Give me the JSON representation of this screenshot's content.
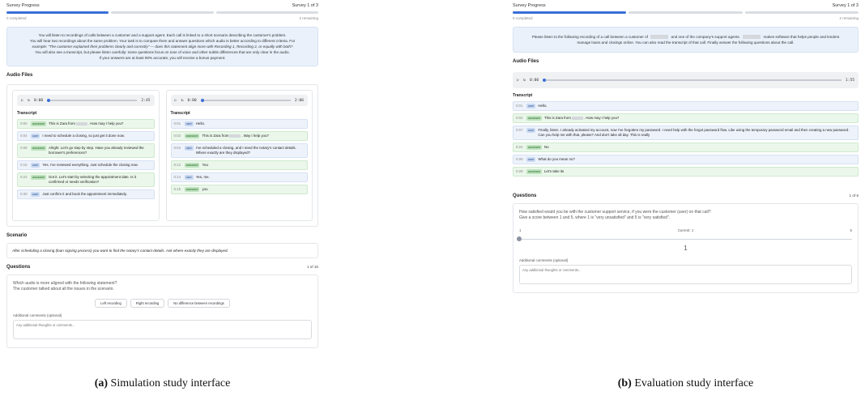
{
  "simulation": {
    "progress": {
      "title": "Survey Progress",
      "survey": "Survey 1 of 3",
      "completed": "0 completed",
      "remaining": "2 remaining"
    },
    "intro": [
      "You will listen to recordings of calls between a customer and a support agent. Each call is linked to a short scenario describing the customer's problem.",
      "You will hear two recordings about the same problem. Your task is to compare them and answer questions which audio is better according to different criteria. For",
      "example: \"The customer explained their problems clearly and correctly\" — does this statement align more with Recording 1, Recording 2, or equally with both?",
      "You will also see a transcript, but please listen carefully: some questions focus on tone of voice and other subtle differences that are only clear in the audio.",
      "If your answers are at least 90% accurate, you will receive a bonus payment."
    ],
    "audio_title": "Audio Files",
    "transcript_label": "Transcript",
    "left": {
      "time": "0:00",
      "duration": "2:45",
      "turns": [
        {
          "t": "0:00",
          "role": "assistant",
          "pre": "This is Zara from",
          "post": ". How may I help you?"
        },
        {
          "t": "0:04",
          "role": "user",
          "pre": "I need to schedule a closing, so just get it done now.",
          "post": ""
        },
        {
          "t": "0:08",
          "role": "assistant",
          "pre": "Alright. Let's go step by step. Have you already reviewed the borrower's preferences?",
          "post": ""
        },
        {
          "t": "0:15",
          "role": "user",
          "pre": "Yes. I've reviewed everything. Just schedule the closing now.",
          "post": ""
        },
        {
          "t": "0:22",
          "role": "assistant",
          "pre": "Got it. Let's start by selecting the appointment date. Is it confirmed or needs verification?",
          "post": ""
        },
        {
          "t": "0:30",
          "role": "user",
          "pre": "Just confirm it and book the appointment immediately.",
          "post": ""
        }
      ]
    },
    "right": {
      "time": "0:00",
      "duration": "2:06",
      "turns": [
        {
          "t": "0:01",
          "role": "user",
          "pre": "Hello.",
          "post": ""
        },
        {
          "t": "0:02",
          "role": "assistant",
          "pre": "This is Zara from",
          "post": ". May I help you?"
        },
        {
          "t": "0:04",
          "role": "user",
          "pre": "I've scheduled a closing, and I need the notary's contact details. Where exactly are they displayed?",
          "post": ""
        },
        {
          "t": "0:12",
          "role": "assistant",
          "pre": "You",
          "post": ""
        },
        {
          "t": "0:14",
          "role": "user",
          "pre": "Yes, me.",
          "post": ""
        },
        {
          "t": "0:15",
          "role": "assistant",
          "pre": "you",
          "post": ""
        }
      ]
    },
    "scenario_title": "Scenario",
    "scenario_text": "After scheduling a closing (loan signing process) you want to find the notary's contact details. Ask where exactly they are displayed.",
    "questions_title": "Questions",
    "questions_count": "1 of 16",
    "question_line1": "Which audio is more aligned with the following statement?",
    "question_line2": "The customer talked about all the issues in the scenario.",
    "choices": [
      "Left recording",
      "Right recording",
      "No difference between recordings"
    ],
    "comments_label": "Additional comments (optional)",
    "comments_placeholder": "Any additional thoughts or comments..."
  },
  "evaluation": {
    "progress": {
      "title": "Survey Progress",
      "survey": "Survey 1 of 3",
      "completed": "0 completed",
      "remaining": "2 remaining"
    },
    "intro_a": "Please listen to the following recording of a call between a customer of",
    "intro_b": "and one of the company's support agents.",
    "intro_c": "makes software that helps",
    "intro_d": "people and lenders manage loans and closings online. You can also read the transcript of that call. Finally answer the following questions about the call.",
    "audio_title": "Audio Files",
    "transcript_label": "Transcript",
    "time": "0:00",
    "duration": "1:55",
    "turns": [
      {
        "t": "0:01",
        "role": "user",
        "pre": "Hello.",
        "post": ""
      },
      {
        "t": "0:02",
        "role": "assistant",
        "pre": "This is Zara from",
        "post": ". How may I help you?"
      },
      {
        "t": "0:07",
        "role": "user",
        "pre": "Finally, listen. I already activated my account, now I've forgotten my password. I need help with the forgot password flow. Like using the temporary password email and then creating a new password. Can you help me with that, please? And don't take all day. This is really",
        "post": ""
      },
      {
        "t": "0:24",
        "role": "assistant",
        "pre": "No",
        "post": ""
      },
      {
        "t": "0:26",
        "role": "user",
        "pre": "What do you mean no?",
        "post": ""
      },
      {
        "t": "0:28",
        "role": "assistant",
        "pre": "Let's take its",
        "post": ""
      }
    ],
    "questions_title": "Questions",
    "questions_count": "1 of 6",
    "question_line1": "How satisfied would you be with the customer support service, if you were the customer (user) on that call?",
    "question_line2": "Give a score between 1 and 5, where 1 is \"very unsatisfied\" and 5 is \"very satisfied\".",
    "slider_min": "1",
    "slider_current": "Current: 1",
    "slider_max": "5",
    "slider_value": 1,
    "slider_display": "1",
    "comments_label": "Additional comments (optional)",
    "comments_placeholder": "Any additional thoughts or comments..."
  },
  "captions": {
    "a_label": "(a)",
    "a_text": "Simulation study interface",
    "b_label": "(b)",
    "b_text": "Evaluation study interface"
  }
}
